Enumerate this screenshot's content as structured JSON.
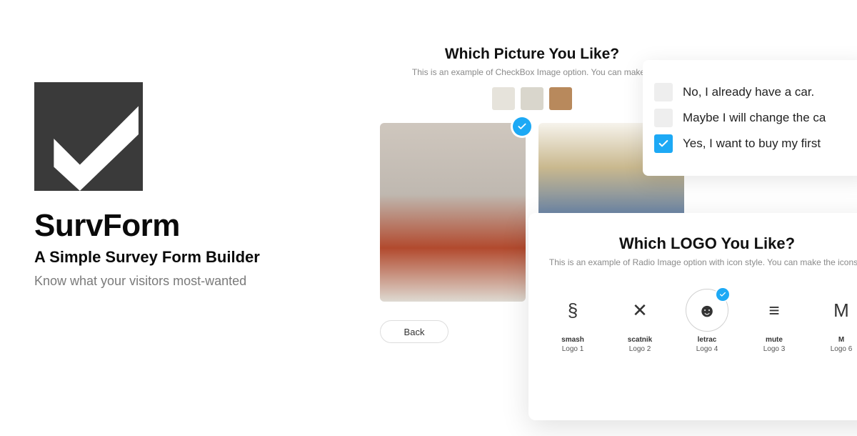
{
  "hero": {
    "product_name": "SurvForm",
    "subtitle": "A Simple Survey Form Builder",
    "tagline": "Know what your visitors most-wanted"
  },
  "picture_panel": {
    "title": "Which Picture You Like?",
    "description": "This is an example of CheckBox Image option. You can make t!",
    "back_label": "Back"
  },
  "choice_panel": {
    "options": [
      {
        "text": "No, I already have a car.",
        "selected": false
      },
      {
        "text": "Maybe I will change the ca",
        "selected": false
      },
      {
        "text": "Yes, I want to buy my first",
        "selected": true
      }
    ]
  },
  "logo_panel": {
    "title": "Which LOGO You Like?",
    "description": "This is an example of Radio Image option with icon style. You can make the icons a",
    "items": [
      {
        "code": "smash",
        "label": "Logo 1",
        "glyph": "§",
        "selected": false
      },
      {
        "code": "scatnik",
        "label": "Logo 2",
        "glyph": "✕",
        "selected": false
      },
      {
        "code": "letrac",
        "label": "Logo 4",
        "glyph": "☻",
        "selected": true
      },
      {
        "code": "mute",
        "label": "Logo 3",
        "glyph": "≡",
        "selected": false
      },
      {
        "code": "M",
        "label": "Logo 6",
        "glyph": "M",
        "selected": false
      }
    ]
  },
  "colors": {
    "accent": "#1da9f5"
  }
}
